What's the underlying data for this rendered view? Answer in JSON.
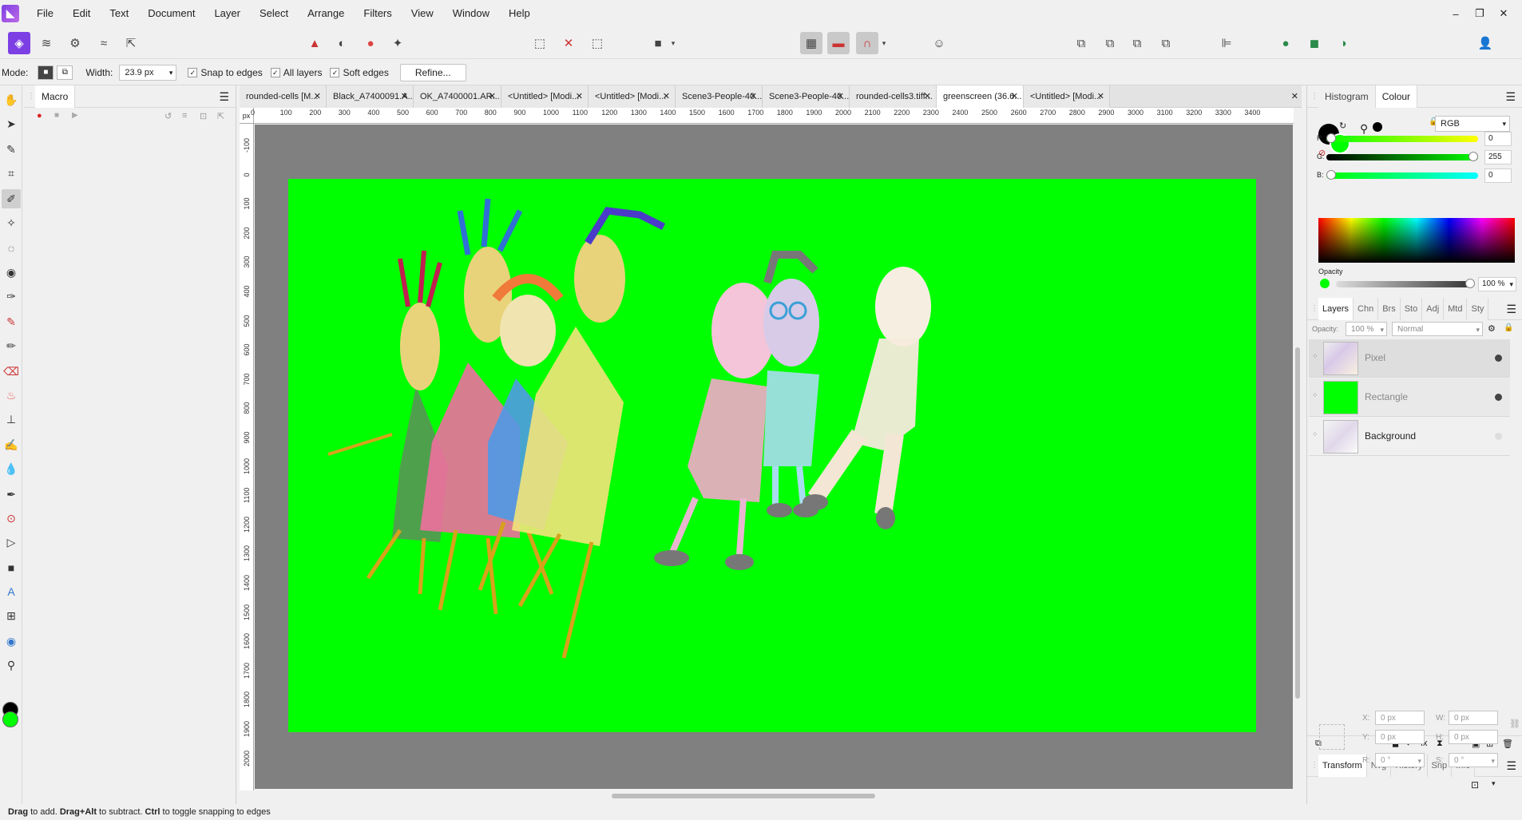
{
  "menu": [
    "File",
    "Edit",
    "Text",
    "Document",
    "Layer",
    "Select",
    "Arrange",
    "Filters",
    "View",
    "Window",
    "Help"
  ],
  "window_controls": [
    "–",
    "❐",
    "✕"
  ],
  "context": {
    "mode_label": "Mode:",
    "width_label": "Width:",
    "width_value": "23.9 px",
    "snap_to_edges": "Snap to edges",
    "all_layers": "All layers",
    "soft_edges": "Soft edges",
    "refine": "Refine..."
  },
  "macro_panel": {
    "tab": "Macro"
  },
  "doc_tabs": [
    "rounded-cells [M...",
    "Black_A7400091.A...",
    "OK_A7400001.AR...",
    "<Untitled> [Modi...",
    "<Untitled> [Modi...",
    "Scene3-People-40...",
    "Scene3-People-40...",
    "rounded-cells3.tiff...",
    "greenscreen (36.6...",
    "<Untitled> [Modi..."
  ],
  "ruler": {
    "corner": "px",
    "h": [
      "0",
      "100",
      "200",
      "300",
      "400",
      "500",
      "600",
      "700",
      "800",
      "900",
      "1000",
      "1100",
      "1200",
      "1300",
      "1400",
      "1500",
      "1600",
      "1700",
      "1800",
      "1900",
      "2000",
      "2100",
      "2200",
      "2300",
      "2400",
      "2500",
      "2600",
      "2700",
      "2800",
      "2900",
      "3000",
      "3100",
      "3200",
      "3300",
      "3400"
    ],
    "v": [
      "-100",
      "0",
      "100",
      "200",
      "300",
      "400",
      "500",
      "600",
      "700",
      "800",
      "900",
      "1000",
      "1100",
      "1200",
      "1300",
      "1400",
      "1500",
      "1600",
      "1700",
      "1800",
      "1900",
      "2000"
    ]
  },
  "colour_panel": {
    "tabs": [
      "Histogram",
      "Colour"
    ],
    "model": "RGB",
    "r_label": "R:",
    "r": "0",
    "g_label": "G:",
    "g": "255",
    "b_label": "B:",
    "b": "0",
    "opacity_label": "Opacity",
    "opacity": "100 %"
  },
  "layers_panel": {
    "tabs": [
      "Layers",
      "Chn",
      "Brs",
      "Sto",
      "Adj",
      "Mtd",
      "Sty"
    ],
    "opacity_label": "Opacity:",
    "opacity": "100 %",
    "blend": "Normal",
    "layers": [
      "Pixel",
      "Rectangle",
      "Background"
    ]
  },
  "transform_panel": {
    "tabs": [
      "Transform",
      "Nvg",
      "History",
      "Snp",
      "Info"
    ],
    "x_label": "X:",
    "x": "0 px",
    "y_label": "Y:",
    "y": "0 px",
    "w_label": "W:",
    "w": "0 px",
    "h_label": "H:",
    "h": "0 px",
    "r_label": "R:",
    "r": "0 °",
    "s_label": "S:",
    "s": "0 °"
  },
  "colors": {
    "canvas_fill": "#00ff00",
    "accent": "#7b3fe4"
  },
  "status": {
    "b1": "Drag",
    "t1": " to add. ",
    "b2": "Drag+Alt",
    "t2": " to subtract. ",
    "b3": "Ctrl",
    "t3": " to toggle snapping to edges"
  }
}
